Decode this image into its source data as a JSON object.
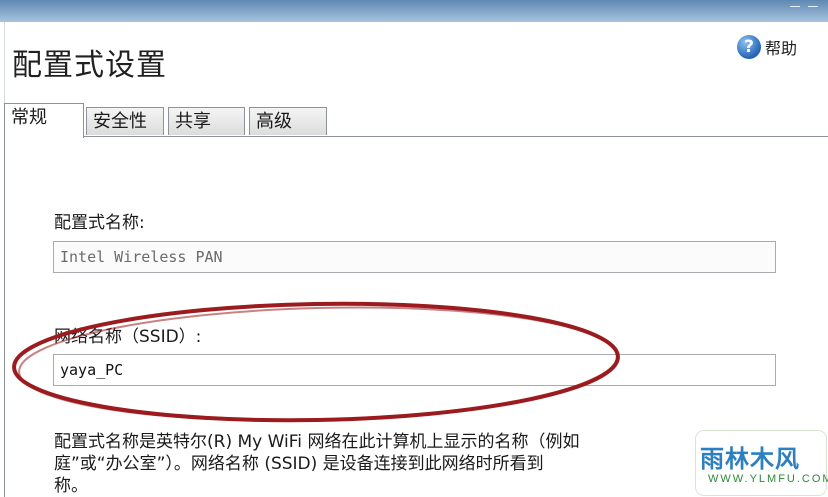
{
  "window": {
    "title": "配置式设置",
    "help_label": "帮助"
  },
  "tabs": [
    {
      "label": "常规",
      "active": true
    },
    {
      "label": "安全性",
      "active": false
    },
    {
      "label": "共享",
      "active": false
    },
    {
      "label": "高级",
      "active": false
    }
  ],
  "form": {
    "profile_name_label": "配置式名称:",
    "profile_name_value": "Intel Wireless PAN",
    "ssid_label": "网络名称（SSID）:",
    "ssid_value": "yaya_PC"
  },
  "description": {
    "line1": "配置式名称是英特尔(R) My WiFi 网络在此计算机上显示的名称（例如",
    "line2": "庭”或“办公室”）。网络名称 (SSID) 是设备连接到此网络时所看到",
    "line3": "称。"
  },
  "annotation": {
    "color": "#9b1b1f"
  },
  "watermark": {
    "brand": "雨林木风",
    "domain": "WWW.YLMFU.COM"
  },
  "colors": {
    "titlebar": "#6d93bb",
    "tab_border": "#8e9299"
  }
}
